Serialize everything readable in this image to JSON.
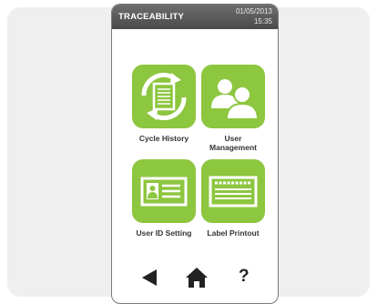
{
  "header": {
    "title": "TRACEABILITY",
    "date": "01/05/2013",
    "time": "15:35"
  },
  "menu": {
    "cycle_history": "Cycle History",
    "user_management_line1": "User",
    "user_management_line2": "Management",
    "user_id_setting": "User ID Setting",
    "label_printout": "Label Printout"
  },
  "nav": {
    "help_label": "?"
  },
  "colors": {
    "accent": "#8dc63f",
    "header": "#555555"
  },
  "icons": [
    "cycle-history-icon",
    "user-management-icon",
    "user-id-card-icon",
    "label-printout-icon",
    "back-arrow-icon",
    "home-icon",
    "help-icon"
  ]
}
